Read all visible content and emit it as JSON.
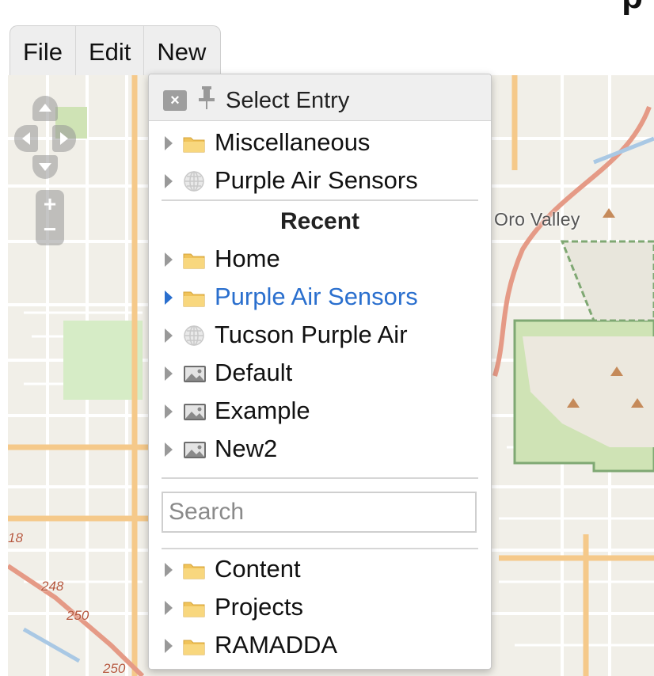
{
  "menubar": {
    "items": [
      "File",
      "Edit",
      "New"
    ]
  },
  "map": {
    "place_label": "Oro Valley",
    "road_labels": [
      "248",
      "250",
      "250",
      "18"
    ],
    "controls": {
      "zoom_in": "+",
      "zoom_out": "−"
    }
  },
  "popup": {
    "title": "Select Entry",
    "close_label": "×",
    "recent_header": "Recent",
    "search_placeholder": "Search",
    "top_entries": [
      {
        "label": "Miscellaneous",
        "icon": "folder-icon"
      },
      {
        "label": "Purple Air Sensors",
        "icon": "globe-icon"
      }
    ],
    "recent_entries": [
      {
        "label": "Home",
        "icon": "folder-icon"
      },
      {
        "label": "Purple Air Sensors",
        "icon": "folder-icon",
        "active": true
      },
      {
        "label": "Tucson Purple Air",
        "icon": "globe-icon"
      },
      {
        "label": "Default",
        "icon": "image-icon"
      },
      {
        "label": "Example",
        "icon": "image-icon"
      },
      {
        "label": "New2",
        "icon": "image-icon"
      }
    ],
    "bottom_entries": [
      {
        "label": "Content",
        "icon": "folder-icon"
      },
      {
        "label": "Projects",
        "icon": "folder-icon"
      },
      {
        "label": "RAMADDA",
        "icon": "folder-icon"
      }
    ]
  },
  "colors": {
    "link_active": "#2a6fce",
    "park_green": "#cfe3b5",
    "road_orange": "#f5c98a"
  }
}
